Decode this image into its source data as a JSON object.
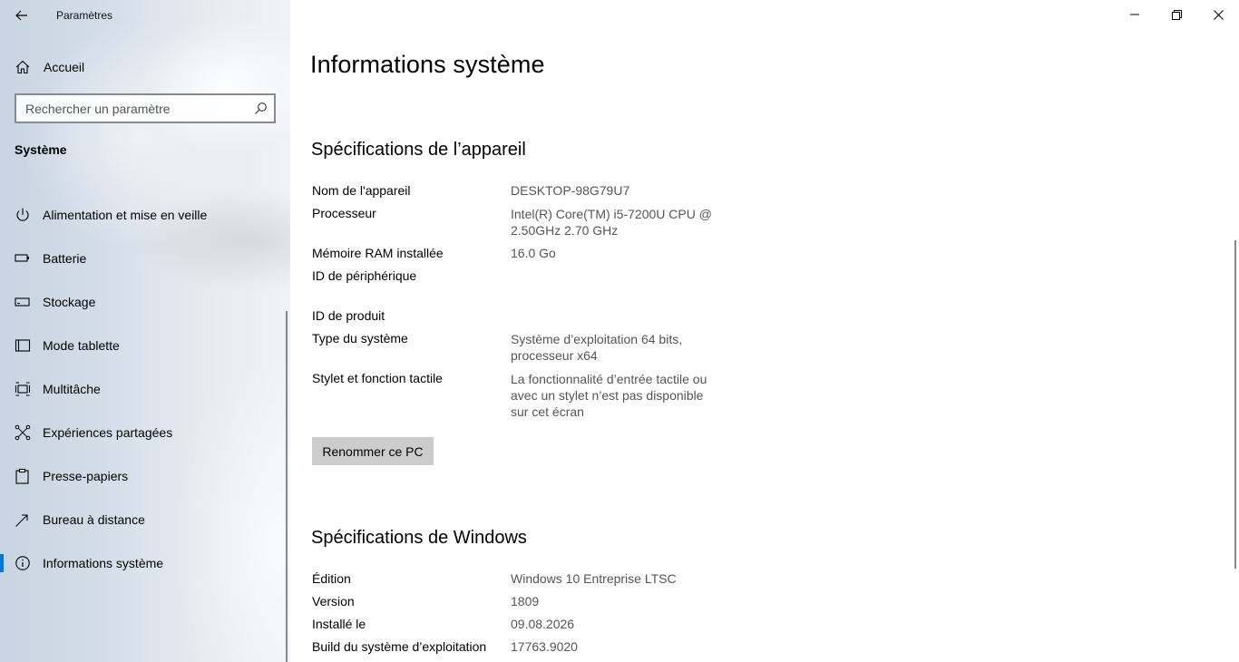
{
  "app": {
    "title": "Paramètres"
  },
  "sidebar": {
    "home_label": "Accueil",
    "search_placeholder": "Rechercher un paramètre",
    "section_title": "Système",
    "items": [
      {
        "label": "Alimentation et mise en veille",
        "icon": "power-icon"
      },
      {
        "label": "Batterie",
        "icon": "battery-icon"
      },
      {
        "label": "Stockage",
        "icon": "storage-icon"
      },
      {
        "label": "Mode tablette",
        "icon": "tablet-icon"
      },
      {
        "label": "Multitâche",
        "icon": "multitask-icon"
      },
      {
        "label": "Expériences partagées",
        "icon": "shared-experiences-icon"
      },
      {
        "label": "Presse-papiers",
        "icon": "clipboard-icon"
      },
      {
        "label": "Bureau à distance",
        "icon": "remote-desktop-icon"
      },
      {
        "label": "Informations système",
        "icon": "info-icon",
        "selected": true
      }
    ]
  },
  "main": {
    "page_title": "Informations système",
    "device_specs": {
      "heading": "Spécifications de l’appareil",
      "rows": [
        {
          "label": "Nom de l'appareil",
          "value": "DESKTOP-98G79U7"
        },
        {
          "label": "Processeur",
          "value_line1": "Intel(R) Core(TM) i5-7200U CPU @",
          "value_line2": "2.50GHz   2.70 GHz"
        },
        {
          "label": "Mémoire RAM installée",
          "value": "16.0 Go"
        },
        {
          "label": "ID de périphérique",
          "value": ""
        },
        {
          "label": "ID de produit",
          "value": ""
        },
        {
          "label": "Type du système",
          "value_line1": "Système d’exploitation 64 bits,",
          "value_line2": "processeur x64"
        },
        {
          "label": "Stylet et fonction tactile",
          "value_line1": "La fonctionnalité d’entrée tactile ou",
          "value_line2": "avec un stylet n’est pas disponible",
          "value_line3": "sur cet écran"
        }
      ],
      "rename_button": "Renommer ce PC"
    },
    "windows_specs": {
      "heading": "Spécifications de Windows",
      "rows": [
        {
          "label": "Édition",
          "value": "Windows 10 Entreprise LTSC"
        },
        {
          "label": "Version",
          "value": "1809"
        },
        {
          "label": "Installé le",
          "value": "09.08.2026"
        },
        {
          "label": "Build du système d’exploitation",
          "value": "17763.9020"
        }
      ]
    }
  },
  "colors": {
    "accent": "#0078d7",
    "button_bg": "#cccccc",
    "value_text": "#555555"
  }
}
